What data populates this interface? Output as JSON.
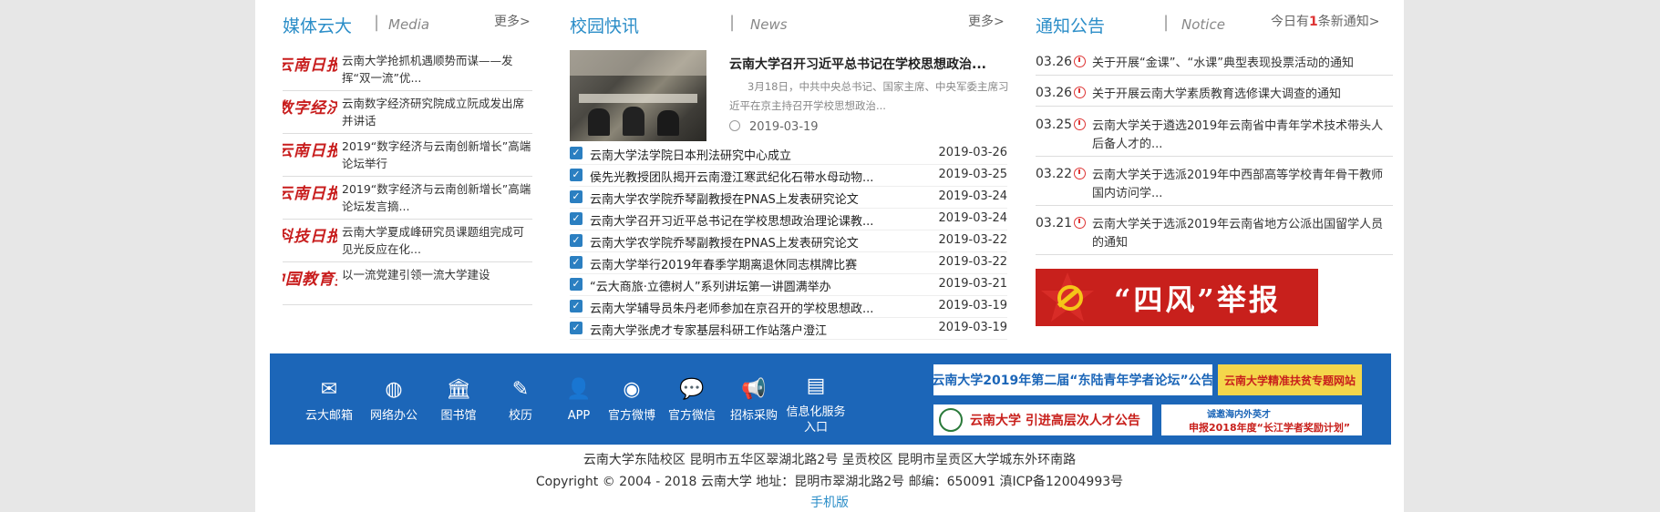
{
  "media": {
    "title": "媒体云大",
    "sep": "|",
    "en": "Media",
    "more": "更多>",
    "items": [
      {
        "source": "云南日报",
        "text": "云南大学抢抓机遇顺势而谋——发挥“双一流”优..."
      },
      {
        "source": "数字经济",
        "text": "云南数字经济研究院成立阮成发出席并讲话"
      },
      {
        "source": "云南日报",
        "text": "2019“数字经济与云南创新增长”高端论坛举行"
      },
      {
        "source": "云南日报",
        "text": "2019“数字经济与云南创新增长”高端论坛发言摘..."
      },
      {
        "source": "科技日报",
        "text": "云南大学夏成峰研究员课题组完成可见光反应在化..."
      },
      {
        "source": "中国教育报",
        "text": "以一流党建引领一流大学建设"
      }
    ]
  },
  "campus": {
    "title": "校园快讯",
    "sep": "|",
    "en": "News",
    "more": "更多>",
    "featured": {
      "title": "云南大学召开习近平总书记在学校思想政治...",
      "summary": "3月18日，中共中央总书记、国家主席、中央军委主席习近平在京主持召开学校思想政治...",
      "date": "2019-03-19"
    },
    "items": [
      {
        "title": "云南大学法学院日本刑法研究中心成立",
        "date": "2019-03-26"
      },
      {
        "title": "侯先光教授团队揭开云南澄江寒武纪化石带水母动物...",
        "date": "2019-03-25"
      },
      {
        "title": "云南大学农学院乔琴副教授在PNAS上发表研究论文",
        "date": "2019-03-24"
      },
      {
        "title": "云南大学召开习近平总书记在学校思想政治理论课教...",
        "date": "2019-03-24"
      },
      {
        "title": "云南大学农学院乔琴副教授在PNAS上发表研究论文",
        "date": "2019-03-22"
      },
      {
        "title": "云南大学举行2019年春季学期离退休同志棋牌比赛",
        "date": "2019-03-22"
      },
      {
        "title": "“云大商旅·立德树人”系列讲坛第一讲圆满举办",
        "date": "2019-03-21"
      },
      {
        "title": "云南大学辅导员朱丹老师参加在京召开的学校思想政...",
        "date": "2019-03-19"
      },
      {
        "title": "云南大学张虎才专家基层科研工作站落户澄江",
        "date": "2019-03-19"
      }
    ]
  },
  "notice": {
    "title": "通知公告",
    "sep": "|",
    "en": "Notice",
    "summary_prefix": "今日有",
    "summary_count": "1",
    "summary_suffix": "条新通知>",
    "items": [
      {
        "date": "03.26",
        "text": "关于开展“金课”、“水课”典型表现投票活动的通知"
      },
      {
        "date": "03.26",
        "text": "关于开展云南大学素质教育选修课大调查的通知"
      },
      {
        "date": "03.25",
        "text": "云南大学关于遴选2019年云南省中青年学术技术带头人后备人才的..."
      },
      {
        "date": "03.22",
        "text": "云南大学关于选派2019年中西部高等学校青年骨干教师国内访问学..."
      },
      {
        "date": "03.21",
        "text": "云南大学关于选派2019年云南省地方公派出国留学人员的通知"
      }
    ],
    "report_banner": "“四风”举报"
  },
  "services": [
    {
      "icon": "mail-icon",
      "label": "云大邮箱"
    },
    {
      "icon": "globe-icon",
      "label": "网络办公"
    },
    {
      "icon": "library-icon",
      "label": "图书馆"
    },
    {
      "icon": "calendar-edit-icon",
      "label": "校历"
    },
    {
      "icon": "person-icon",
      "label": "APP"
    },
    {
      "icon": "weibo-icon",
      "label": "官方微博"
    },
    {
      "icon": "wechat-icon",
      "label": "官方微信"
    },
    {
      "icon": "megaphone-icon",
      "label": "招标采购"
    },
    {
      "icon": "info-icon",
      "label": "信息化服务入口"
    }
  ],
  "banners": {
    "forum": "云南大学2019年第二届“东陆青年学者论坛”公告",
    "poverty": "云南大学精准扶贫专题网站",
    "talent": "云南大学 引进高层次人才公告",
    "changjiang": "申报2018年度“长江学者奖励计划”",
    "changjiang_top": "诚邀海内外英才"
  },
  "footer": {
    "address": "云南大学东陆校区 昆明市五华区翠湖北路2号 呈贡校区 昆明市呈贡区大学城东外环南路",
    "copyright": "Copyright © 2004 - 2018 云南大学 地址：昆明市翠湖北路2号 邮编：650091 滇ICP备12004993号",
    "mobile": "手机版"
  },
  "colors": {
    "accent": "#2c8ec8",
    "bar": "#1c66b8",
    "red": "#c81d1d"
  }
}
